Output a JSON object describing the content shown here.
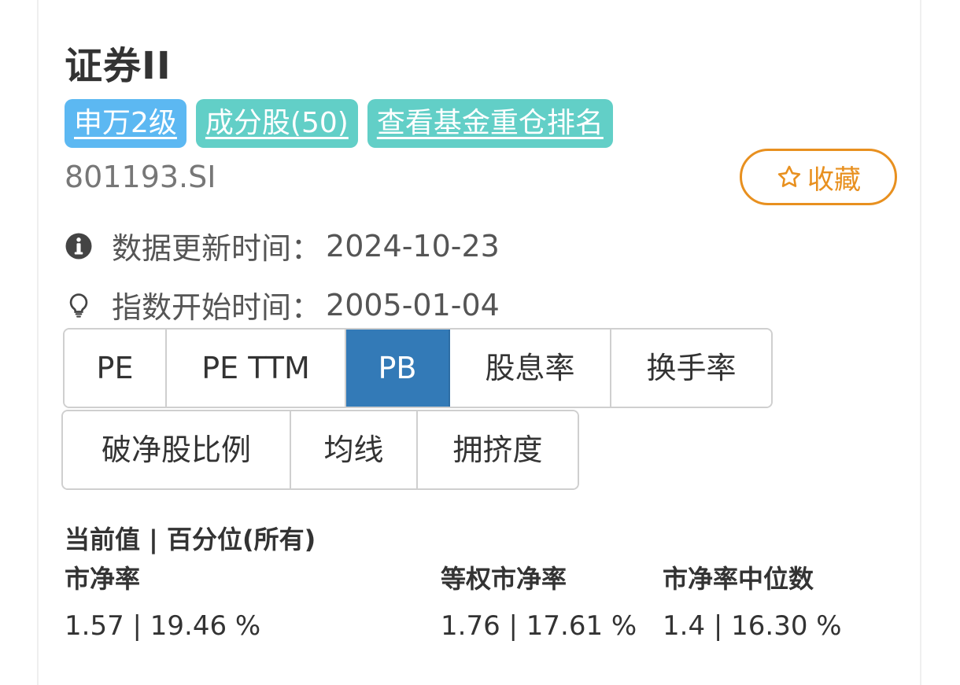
{
  "header": {
    "title": "证券II",
    "code": "801193.SI"
  },
  "tags": [
    {
      "label": "申万2级",
      "color": "#5cb8f2"
    },
    {
      "label": "成分股(50)",
      "color": "#62cfc7"
    },
    {
      "label": "查看基金重仓排名",
      "color": "#62cfc7"
    }
  ],
  "favorite": {
    "label": "收藏",
    "icon": "star-outline-icon",
    "color": "#e8901f"
  },
  "info": {
    "update_label": "数据更新时间：",
    "update_value": "2024-10-23",
    "update_icon": "info-circle-icon",
    "start_label": "指数开始时间：",
    "start_value": "2005-01-04",
    "start_icon": "lightbulb-icon"
  },
  "tabs_row1": [
    {
      "label": "PE",
      "active": false
    },
    {
      "label": "PE TTM",
      "active": false
    },
    {
      "label": "PB",
      "active": true
    },
    {
      "label": "股息率",
      "active": false
    },
    {
      "label": "换手率",
      "active": false
    }
  ],
  "tabs_row2": [
    {
      "label": "破净股比例",
      "active": false
    },
    {
      "label": "均线",
      "active": false
    },
    {
      "label": "拥挤度",
      "active": false
    }
  ],
  "active_color": "#337ab7",
  "stats": {
    "section_title": "当前值 | 百分位(所有)",
    "items": [
      {
        "label": "市净率",
        "value": "1.57 | 19.46 %"
      },
      {
        "label": "等权市净率",
        "value": "1.76 | 17.61 %"
      },
      {
        "label": "市净率中位数",
        "value": "1.4 | 16.30 %"
      }
    ]
  }
}
